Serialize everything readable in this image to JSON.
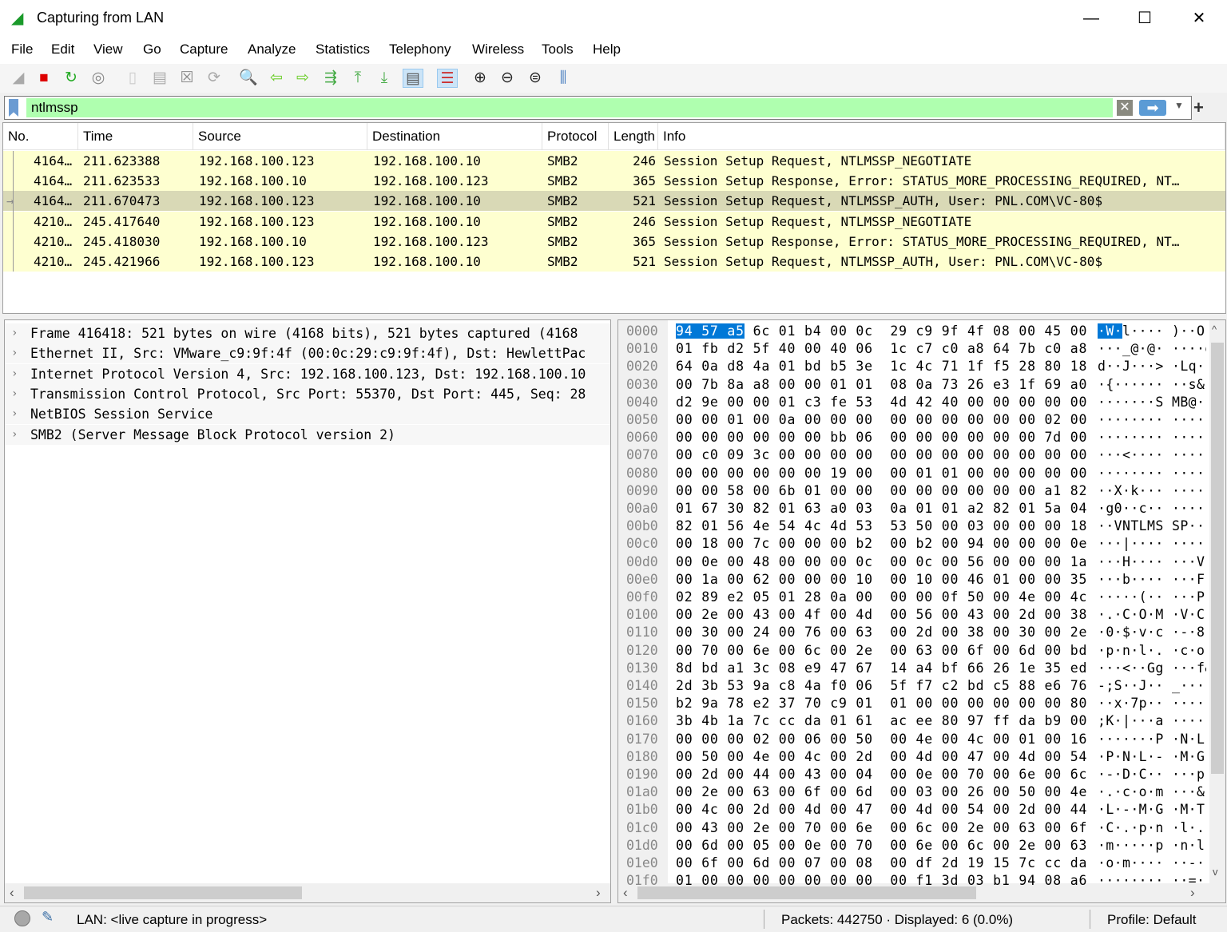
{
  "window": {
    "title": "Capturing from LAN",
    "icon": "wireshark-fin-icon"
  },
  "menu": [
    "File",
    "Edit",
    "View",
    "Go",
    "Capture",
    "Analyze",
    "Statistics",
    "Telephony",
    "Wireless",
    "Tools",
    "Help"
  ],
  "toolbar": [
    "start-capture-icon",
    "stop-capture-icon",
    "restart-capture-icon",
    "capture-options-icon",
    "open-file-icon",
    "save-file-icon",
    "close-file-icon",
    "reload-file-icon",
    "find-packet-icon",
    "go-back-icon",
    "go-forward-icon",
    "go-to-packet-icon",
    "first-packet-icon",
    "last-packet-icon",
    "auto-scroll-icon",
    "colorize-icon",
    "zoom-in-icon",
    "zoom-out-icon",
    "normal-size-icon",
    "resize-columns-icon"
  ],
  "filter": {
    "value": "ntlmssp",
    "color": "#afffaf"
  },
  "packet_list": {
    "columns": [
      "No.",
      "Time",
      "Source",
      "Destination",
      "Protocol",
      "Length",
      "Info"
    ],
    "rows": [
      {
        "no": "4164…",
        "time": "211.623388",
        "src": "192.168.100.123",
        "dst": "192.168.100.10",
        "proto": "SMB2",
        "len": "246",
        "info": "Session Setup Request, NTLMSSP_NEGOTIATE"
      },
      {
        "no": "4164…",
        "time": "211.623533",
        "src": "192.168.100.10",
        "dst": "192.168.100.123",
        "proto": "SMB2",
        "len": "365",
        "info": "Session Setup Response, Error: STATUS_MORE_PROCESSING_REQUIRED, NT…"
      },
      {
        "no": "4164…",
        "time": "211.670473",
        "src": "192.168.100.123",
        "dst": "192.168.100.10",
        "proto": "SMB2",
        "len": "521",
        "info": "Session Setup Request, NTLMSSP_AUTH, User: PNL.COM\\VC-80$",
        "selected": true
      },
      {
        "no": "4210…",
        "time": "245.417640",
        "src": "192.168.100.123",
        "dst": "192.168.100.10",
        "proto": "SMB2",
        "len": "246",
        "info": "Session Setup Request, NTLMSSP_NEGOTIATE"
      },
      {
        "no": "4210…",
        "time": "245.418030",
        "src": "192.168.100.10",
        "dst": "192.168.100.123",
        "proto": "SMB2",
        "len": "365",
        "info": "Session Setup Response, Error: STATUS_MORE_PROCESSING_REQUIRED, NT…"
      },
      {
        "no": "4210…",
        "time": "245.421966",
        "src": "192.168.100.123",
        "dst": "192.168.100.10",
        "proto": "SMB2",
        "len": "521",
        "info": "Session Setup Request, NTLMSSP_AUTH, User: PNL.COM\\VC-80$"
      }
    ]
  },
  "details": [
    "Frame 416418: 521 bytes on wire (4168 bits), 521 bytes captured (4168",
    "Ethernet II, Src: VMware_c9:9f:4f (00:0c:29:c9:9f:4f), Dst: HewlettPac",
    "Internet Protocol Version 4, Src: 192.168.100.123, Dst: 192.168.100.10",
    "Transmission Control Protocol, Src Port: 55370, Dst Port: 445, Seq: 28",
    "NetBIOS Session Service",
    "SMB2 (Server Message Block Protocol version 2)"
  ],
  "hex": [
    [
      "0000",
      "94 57 a5 6c 01 b4 00 0c 29 c9 9f 4f 08 00 45 00"
    ],
    [
      "0010",
      "01 fb d2 5f 40 00 40 06 1c c7 c0 a8 64 7b c0 a8"
    ],
    [
      "0020",
      "64 0a d8 4a 01 bd b5 3e 1c 4c 71 1f f5 28 80 18"
    ],
    [
      "0030",
      "00 7b 8a a8 00 00 01 01 08 0a 73 26 e3 1f 69 a0"
    ],
    [
      "0040",
      "d2 9e 00 00 01 c3 fe 53 4d 42 40 00 00 00 00 00"
    ],
    [
      "0050",
      "00 00 01 00 0a 00 00 00 00 00 00 00 00 00 02 00"
    ],
    [
      "0060",
      "00 00 00 00 00 00 bb 06 00 00 00 00 00 00 7d 00"
    ],
    [
      "0070",
      "00 c0 09 3c 00 00 00 00 00 00 00 00 00 00 00 00"
    ],
    [
      "0080",
      "00 00 00 00 00 00 19 00 00 01 01 00 00 00 00 00"
    ],
    [
      "0090",
      "00 00 58 00 6b 01 00 00 00 00 00 00 00 00 a1 82"
    ],
    [
      "00a0",
      "01 67 30 82 01 63 a0 03 0a 01 01 a2 82 01 5a 04"
    ],
    [
      "00b0",
      "82 01 56 4e 54 4c 4d 53 53 50 00 03 00 00 00 18"
    ],
    [
      "00c0",
      "00 18 00 7c 00 00 00 b2 00 b2 00 94 00 00 00 0e"
    ],
    [
      "00d0",
      "00 0e 00 48 00 00 00 0c 00 0c 00 56 00 00 00 1a"
    ],
    [
      "00e0",
      "00 1a 00 62 00 00 00 10 00 10 00 46 01 00 00 35"
    ],
    [
      "00f0",
      "02 89 e2 05 01 28 0a 00 00 00 0f 50 00 4e 00 4c"
    ],
    [
      "0100",
      "00 2e 00 43 00 4f 00 4d 00 56 00 43 00 2d 00 38"
    ],
    [
      "0110",
      "00 30 00 24 00 76 00 63 00 2d 00 38 00 30 00 2e"
    ],
    [
      "0120",
      "00 70 00 6e 00 6c 00 2e 00 63 00 6f 00 6d 00 bd"
    ],
    [
      "0130",
      "8d bd a1 3c 08 e9 47 67 14 a4 bf 66 26 1e 35 ed"
    ],
    [
      "0140",
      "2d 3b 53 9a c8 4a f0 06 5f f7 c2 bd c5 88 e6 76"
    ],
    [
      "0150",
      "b2 9a 78 e2 37 70 c9 01 01 00 00 00 00 00 00 80"
    ],
    [
      "0160",
      "3b 4b 1a 7c cc da 01 61 ac ee 80 97 ff da b9 00"
    ],
    [
      "0170",
      "00 00 00 02 00 06 00 50 00 4e 00 4c 00 01 00 16"
    ],
    [
      "0180",
      "00 50 00 4e 00 4c 00 2d 00 4d 00 47 00 4d 00 54"
    ],
    [
      "0190",
      "00 2d 00 44 00 43 00 04 00 0e 00 70 00 6e 00 6c"
    ],
    [
      "01a0",
      "00 2e 00 63 00 6f 00 6d 00 03 00 26 00 50 00 4e"
    ],
    [
      "01b0",
      "00 4c 00 2d 00 4d 00 47 00 4d 00 54 00 2d 00 44"
    ],
    [
      "01c0",
      "00 43 00 2e 00 70 00 6e 00 6c 00 2e 00 63 00 6f"
    ],
    [
      "01d0",
      "00 6d 00 05 00 0e 00 70 00 6e 00 6c 00 2e 00 63"
    ],
    [
      "01e0",
      "00 6f 00 6d 00 07 00 08 00 df 2d 19 15 7c cc da"
    ],
    [
      "01f0",
      "01 00 00 00 00 00 00 00 00 f1 3d 03 b1 94 08 a6"
    ]
  ],
  "status": {
    "capture": "LAN: <live capture in progress>",
    "packets": "Packets: 442750 · Displayed: 6 (0.0%)",
    "profile": "Profile: Default"
  }
}
